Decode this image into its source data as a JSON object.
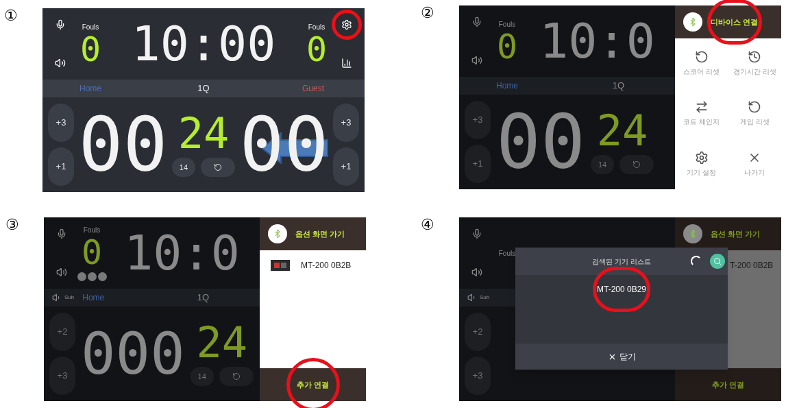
{
  "panels": [
    {
      "marker": "①",
      "dimmed": false,
      "board": {
        "home_fouls": {
          "label": "Fouls",
          "value": "0"
        },
        "clock": "10:00",
        "guest_fouls": {
          "label": "Fouls",
          "value": "0"
        },
        "settings": {
          "highlighted": true
        },
        "home": "Home",
        "period": "1Q",
        "guest": "Guest",
        "home_buttons": [
          "+3",
          "+1"
        ],
        "home_score": "00",
        "shot_clock": "24",
        "shot_reset": "14",
        "guest_score": "00",
        "guest_buttons": [
          "+3",
          "+1"
        ],
        "arrow": true
      }
    },
    {
      "marker": "②",
      "dimmed": true,
      "board": {
        "home_fouls": {
          "label": "Fouls",
          "value": "0"
        },
        "clock": "10:0",
        "home": "Home",
        "period": "1Q",
        "home_buttons": [
          "+3",
          "+1"
        ],
        "home_score": "00",
        "shot_clock": "24",
        "shot_reset": "14"
      },
      "drawer": {
        "kind": "menu",
        "title": "디바이스 연결",
        "title_highlighted": true,
        "items": [
          "스코어 리셋",
          "경기시간 리셋",
          "코트 체인지",
          "게임 리셋",
          "기기 설정",
          "나가기"
        ]
      }
    },
    {
      "marker": "③",
      "dimmed": true,
      "board": {
        "home_fouls": {
          "label": "Fouls",
          "value": "0"
        },
        "timeouts": [
          {
            "lit": false
          },
          {
            "lit": false
          },
          {
            "lit": false
          }
        ],
        "clock": "10:0",
        "sub": "Sub",
        "home": "Home",
        "period": "1Q",
        "home_buttons": [
          "+2",
          "+3"
        ],
        "home_score": "000",
        "shot_clock": "24",
        "shot_reset": "14"
      },
      "drawer": {
        "kind": "devices",
        "title": "옵션 화면 가기",
        "devices": [
          {
            "name": "MT-200 0B2B",
            "thumbnail": true
          }
        ],
        "footer": "추가 연결",
        "footer_highlighted": true
      }
    },
    {
      "marker": "④",
      "dimmed": true,
      "board": {
        "home_fouls": {
          "label": "Fouls"
        },
        "sub": "Sub",
        "home_buttons": [
          "+2",
          "+3"
        ]
      },
      "drawer": {
        "kind": "devices",
        "title": "옵션 화면 가기",
        "devices": [
          {
            "name": "T-200 0B2B"
          }
        ],
        "footer": "추가 연결"
      },
      "dialog": {
        "title": "검색된 기기 리스트",
        "items": [
          {
            "name": "MT-200 0B29",
            "highlighted": true
          }
        ],
        "close": "닫기"
      }
    }
  ]
}
